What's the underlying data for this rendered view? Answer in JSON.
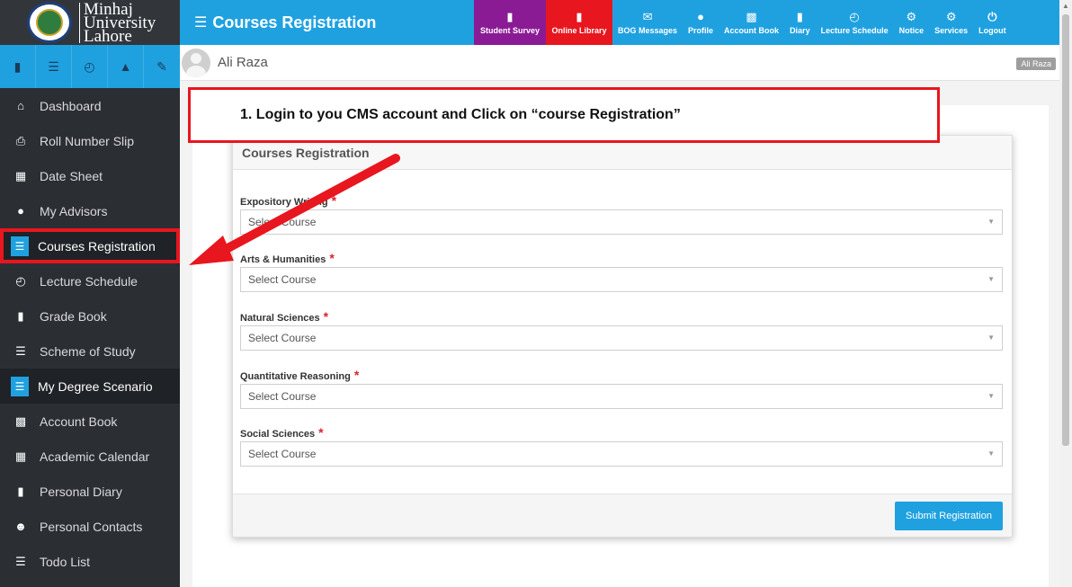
{
  "brand": {
    "line1": "Minhaj",
    "line2": "University",
    "line3": "Lahore",
    "accent": "#1fa1e0",
    "highlight": "#e8161e"
  },
  "iconbar": [
    "file-icon",
    "list-icon",
    "clock-icon",
    "sitemap-icon",
    "wrench-icon"
  ],
  "sidebar": {
    "items": [
      {
        "label": "Dashboard",
        "icon": "home-icon"
      },
      {
        "label": "Roll Number Slip",
        "icon": "print-icon"
      },
      {
        "label": "Date Sheet",
        "icon": "calendar-icon"
      },
      {
        "label": "My Advisors",
        "icon": "user-icon"
      },
      {
        "label": "Courses Registration",
        "icon": "list-icon"
      },
      {
        "label": "Lecture Schedule",
        "icon": "clock-icon"
      },
      {
        "label": "Grade Book",
        "icon": "book-icon"
      },
      {
        "label": "Scheme of Study",
        "icon": "list-icon"
      },
      {
        "label": "My Degree Scenario",
        "icon": "list-icon"
      },
      {
        "label": "Account Book",
        "icon": "money-icon"
      },
      {
        "label": "Academic Calendar",
        "icon": "calendar-icon"
      },
      {
        "label": "Personal Diary",
        "icon": "file-icon"
      },
      {
        "label": "Personal Contacts",
        "icon": "users-icon"
      },
      {
        "label": "Todo List",
        "icon": "list-icon"
      }
    ]
  },
  "header": {
    "title": "Courses Registration",
    "nav": [
      {
        "label": "Student Survey",
        "icon": "book-icon"
      },
      {
        "label": "Online Library",
        "icon": "book-icon"
      },
      {
        "label": "BOG Messages",
        "icon": "envelope-icon"
      },
      {
        "label": "Profile",
        "icon": "user-icon"
      },
      {
        "label": "Account Book",
        "icon": "money-icon"
      },
      {
        "label": "Diary",
        "icon": "file-icon"
      },
      {
        "label": "Lecture Schedule",
        "icon": "clock-icon"
      },
      {
        "label": "Notice",
        "icon": "cogs-icon"
      },
      {
        "label": "Services",
        "icon": "cogs-icon"
      },
      {
        "label": "Logout",
        "icon": "power-icon"
      }
    ]
  },
  "user": {
    "name": "Ali Raza",
    "badge": "Ali Raza"
  },
  "instruction": "1.   Login to you CMS account and Click on “course Registration”",
  "form": {
    "title": "Courses Registration",
    "fields": [
      {
        "label": "Expository Writing",
        "placeholder": "Select Course"
      },
      {
        "label": "Arts & Humanities",
        "placeholder": "Select Course"
      },
      {
        "label": "Natural Sciences",
        "placeholder": "Select Course"
      },
      {
        "label": "Quantitative Reasoning",
        "placeholder": "Select Course"
      },
      {
        "label": "Social Sciences",
        "placeholder": "Select Course"
      }
    ],
    "required_mark": "*",
    "submit_label": "Submit Registration"
  }
}
